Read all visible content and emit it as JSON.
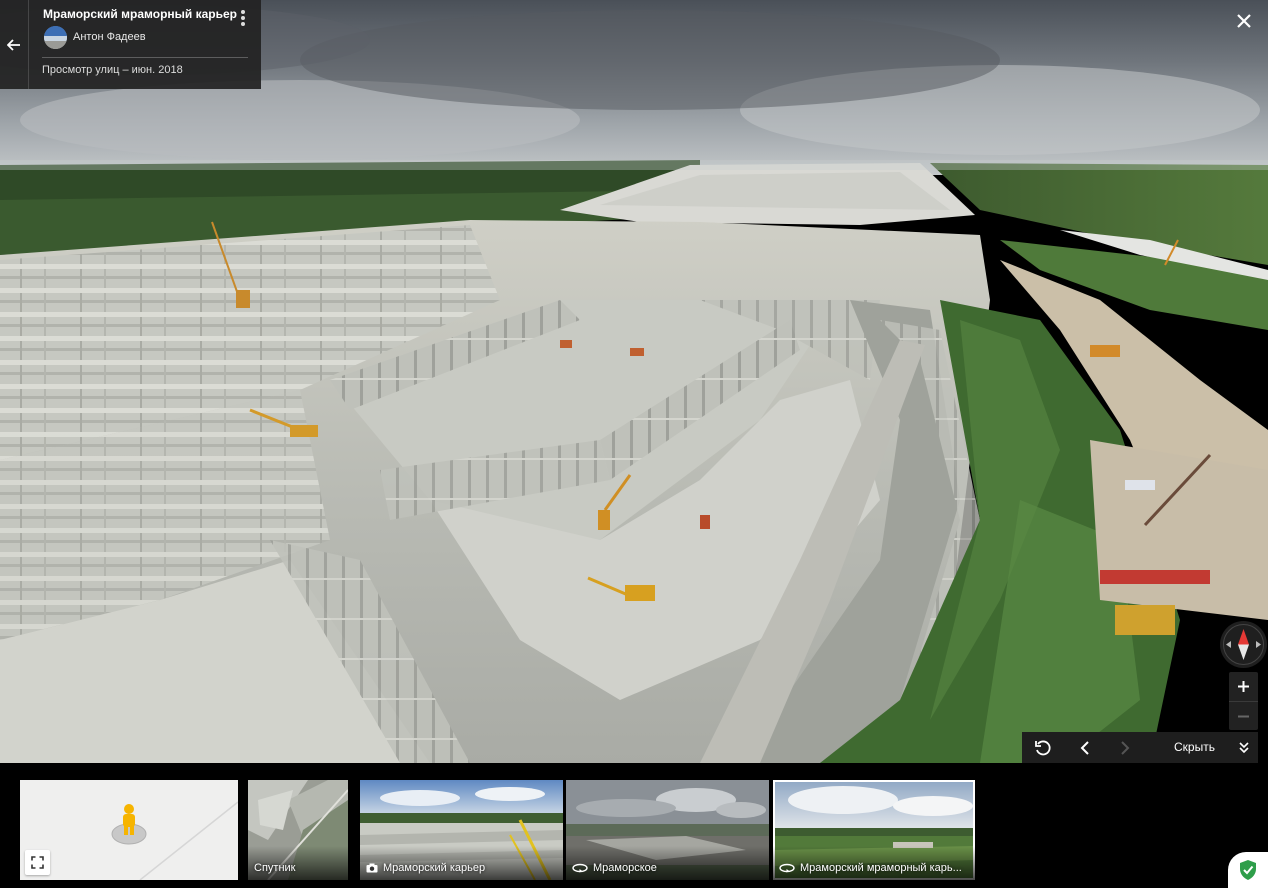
{
  "info_card": {
    "title": "Мраморский мраморный карьер",
    "author": "Антон Фадеев",
    "date_line": "Просмотр улиц – июн. 2018"
  },
  "controls": {
    "hide_label": "Скрыть"
  },
  "thumbnails": {
    "satellite_label": "Спутник",
    "photos": [
      {
        "label": "Мраморский карьер",
        "icon": "camera-icon"
      },
      {
        "label": "Мраморское",
        "icon": "panorama-360-icon"
      },
      {
        "label": "Мраморский мраморный карь...",
        "icon": "panorama-360-icon"
      }
    ]
  },
  "colors": {
    "panel_bg": "#222222",
    "compass_north": "#e53935",
    "shield_green": "#2e9e4a"
  }
}
